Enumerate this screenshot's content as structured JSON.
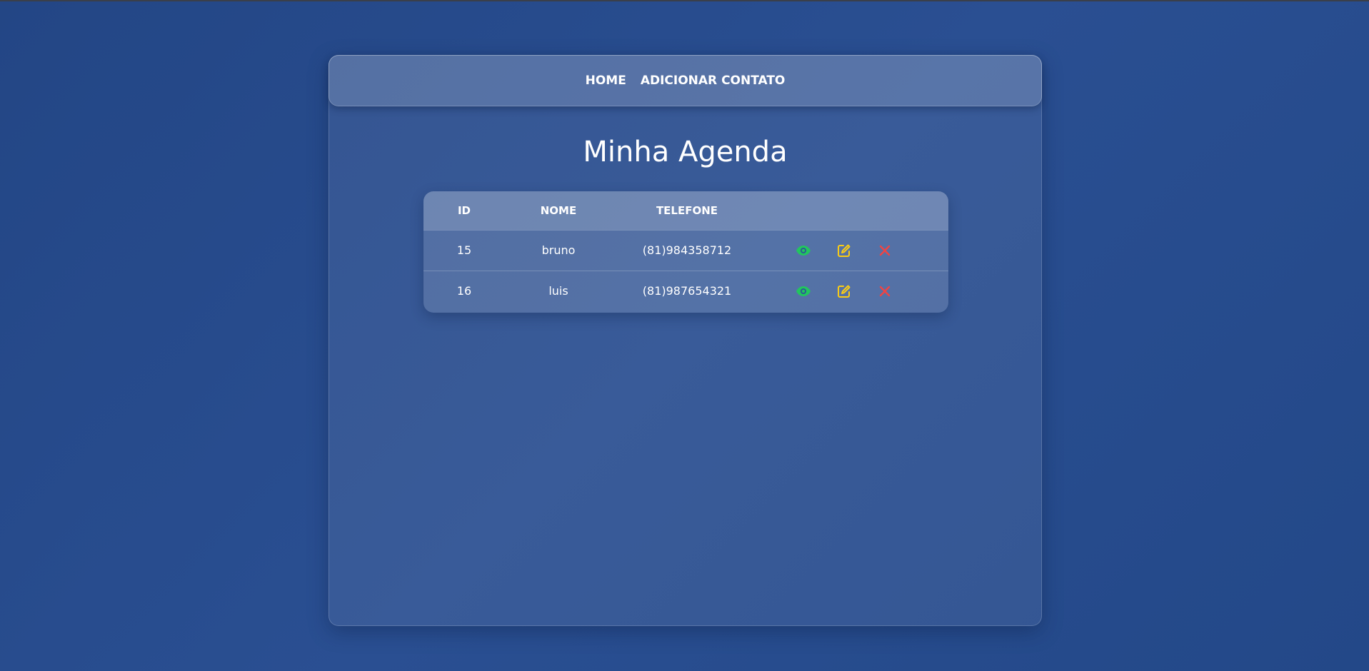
{
  "nav": {
    "home_label": "HOME",
    "add_contact_label": "ADICIONAR CONTATO"
  },
  "page": {
    "title": "Minha Agenda"
  },
  "table": {
    "headers": [
      "ID",
      "NOME",
      "TELEFONE",
      ""
    ],
    "rows": [
      {
        "id": "15",
        "nome": "bruno",
        "telefone": "(81)984358712"
      },
      {
        "id": "16",
        "nome": "luis",
        "telefone": "(81)987654321"
      }
    ],
    "actions": [
      {
        "icon": "eye-icon",
        "color": "#22c55e"
      },
      {
        "icon": "edit-icon",
        "color": "#facc15"
      },
      {
        "icon": "close-icon",
        "color": "#ef4444"
      }
    ]
  },
  "colors": {
    "background": "#25498c",
    "view": "#22c55e",
    "edit": "#facc15",
    "delete": "#ef4444"
  }
}
